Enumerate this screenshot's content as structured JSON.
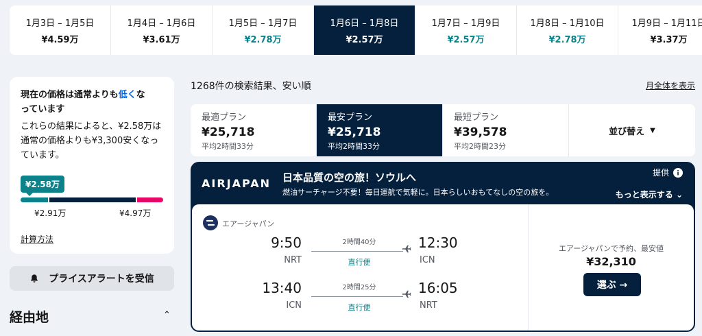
{
  "date_strip": [
    {
      "range": "1月3日 – 1月5日",
      "price": "¥4.59万",
      "low": false,
      "active": false
    },
    {
      "range": "1月4日 – 1月6日",
      "price": "¥3.61万",
      "low": false,
      "active": false
    },
    {
      "range": "1月5日 – 1月7日",
      "price": "¥2.78万",
      "low": true,
      "active": false
    },
    {
      "range": "1月6日 – 1月8日",
      "price": "¥2.57万",
      "low": true,
      "active": true
    },
    {
      "range": "1月7日 – 1月9日",
      "price": "¥2.57万",
      "low": true,
      "active": false
    },
    {
      "range": "1月8日 – 1月10日",
      "price": "¥2.78万",
      "low": true,
      "active": false
    },
    {
      "range": "1月9日 – 1月11日",
      "price": "¥3.37万",
      "low": false,
      "active": false
    }
  ],
  "price_card": {
    "title_a": "現在の価格は通常よりも",
    "title_hl": "低く",
    "title_b": "な",
    "title_c": "っています",
    "desc": "これらの結果によると、¥2.58万は通常の価格よりも¥3,300安くなっています。",
    "current_price": "¥2.58万",
    "low_label": "¥2.91万",
    "high_label": "¥4.97万",
    "method_link": "計算方法"
  },
  "price_alert": {
    "label": "プライスアラートを受信"
  },
  "filters": {
    "stops_title": "経由地",
    "stops_caret": "⌃"
  },
  "results": {
    "count_text": "1268件の検索結果、安い順",
    "month_link": "月全体を表示"
  },
  "sort_tabs": [
    {
      "label": "最適プラン",
      "price": "¥25,718",
      "duration": "平均2時間33分",
      "active": false
    },
    {
      "label": "最安プラン",
      "price": "¥25,718",
      "duration": "平均2時間33分",
      "active": true
    },
    {
      "label": "最短プラン",
      "price": "¥39,578",
      "duration": "平均2時間23分",
      "active": false
    }
  ],
  "sort_dropdown": {
    "label": "並び替え",
    "caret": "▼"
  },
  "ad": {
    "logo_text": "AIRJAPAN",
    "headline": "日本品質の空の旅！ソウルへ",
    "subtext": "燃油サーチャージ不要！毎日運航で気軽に。日本らしいおもてなしの空の旅を。",
    "provided": "提供",
    "show_more": "もっと表示する ⌄",
    "airline_name": "エアージャパン",
    "legs": [
      {
        "depart": "9:50",
        "depart_code": "NRT",
        "duration": "2時間40分",
        "stops": "直行便",
        "arrive": "12:30",
        "arrive_code": "ICN"
      },
      {
        "depart": "13:40",
        "depart_code": "ICN",
        "duration": "2時間25分",
        "stops": "直行便",
        "arrive": "16:05",
        "arrive_code": "NRT"
      }
    ],
    "book_label": "エアージャパンで予約、最安値",
    "book_price": "¥32,310",
    "select_button": "選ぶ →"
  },
  "colors": {
    "navy": "#05203c",
    "teal": "#0c838a",
    "pink": "#e70866",
    "link_blue": "#0062e3"
  },
  "icons": [
    "bell-icon",
    "info-icon",
    "plane-icon",
    "airline-logo-icon"
  ]
}
